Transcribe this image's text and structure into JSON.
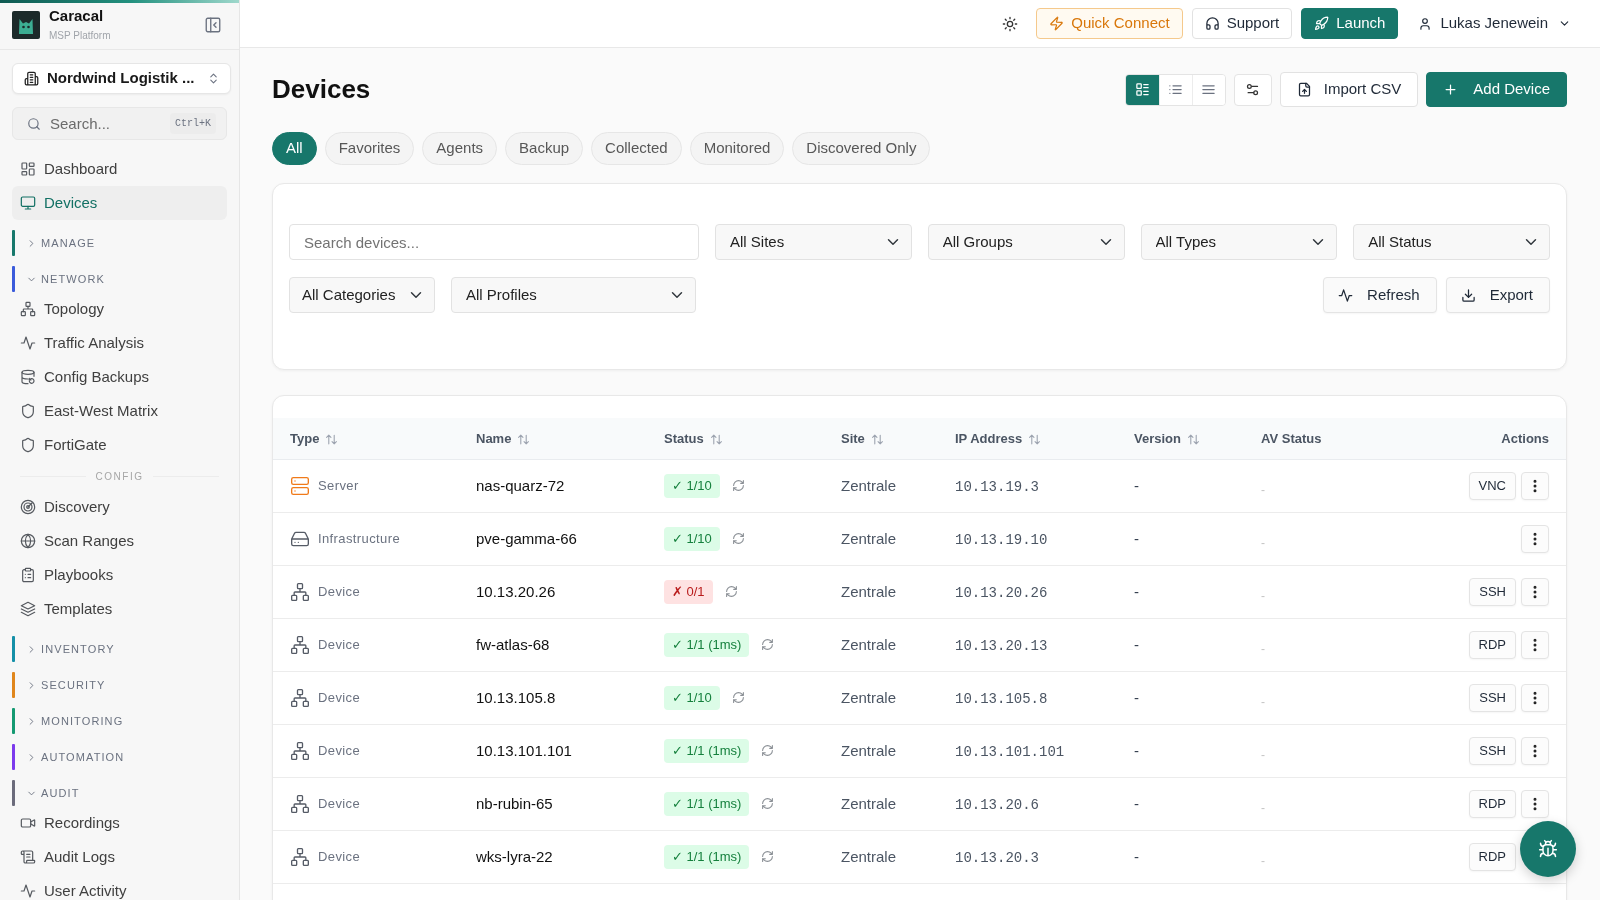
{
  "sidebar": {
    "brand": {
      "name": "Caracal",
      "subtitle": "MSP Platform"
    },
    "org_selector": {
      "value": "Nordwind Logistik ..."
    },
    "search": {
      "placeholder": "Search...",
      "shortcut": "Ctrl+K"
    },
    "nav": [
      {
        "kind": "link",
        "label": "Dashboard",
        "selected": false
      },
      {
        "kind": "link",
        "label": "Devices",
        "selected": true
      },
      {
        "kind": "group",
        "label": "MANAGE",
        "color": "#17786c",
        "expanded": false
      },
      {
        "kind": "group",
        "label": "NETWORK",
        "color": "#3b5bdb",
        "expanded": true,
        "children": [
          {
            "kind": "link",
            "label": "Topology",
            "selected": false
          },
          {
            "kind": "link",
            "label": "Traffic Analysis",
            "selected": false
          },
          {
            "kind": "link",
            "label": "Config Backups",
            "selected": false
          },
          {
            "kind": "link",
            "label": "East-West Matrix",
            "selected": false
          },
          {
            "kind": "link",
            "label": "FortiGate",
            "selected": false
          },
          {
            "kind": "heading",
            "label": "CONFIG"
          },
          {
            "kind": "link",
            "label": "Discovery",
            "selected": false
          },
          {
            "kind": "link",
            "label": "Scan Ranges",
            "selected": false
          },
          {
            "kind": "link",
            "label": "Playbooks",
            "selected": false
          },
          {
            "kind": "link",
            "label": "Templates",
            "selected": false
          }
        ]
      },
      {
        "kind": "group",
        "label": "INVENTORY",
        "color": "#1590a8",
        "expanded": false
      },
      {
        "kind": "group",
        "label": "SECURITY",
        "color": "#e0861c",
        "expanded": false
      },
      {
        "kind": "group",
        "label": "MONITORING",
        "color": "#159a72",
        "expanded": false
      },
      {
        "kind": "group",
        "label": "AUTOMATION",
        "color": "#7c3aed",
        "expanded": false
      },
      {
        "kind": "group",
        "label": "AUDIT",
        "color": "#6b6b7b",
        "expanded": true,
        "children": [
          {
            "kind": "link",
            "label": "Recordings",
            "selected": false
          },
          {
            "kind": "link",
            "label": "Audit Logs",
            "selected": false
          },
          {
            "kind": "link",
            "label": "User Activity",
            "selected": false
          }
        ]
      }
    ]
  },
  "topbar": {
    "actions": [
      {
        "kind": "warning",
        "label": "Quick Connect"
      },
      {
        "kind": "outline",
        "label": "Support"
      },
      {
        "kind": "primary",
        "label": "Launch"
      }
    ],
    "user": {
      "name": "Lukas Jenewein"
    }
  },
  "header": {
    "title": "Devices",
    "view_modes": [
      {
        "selected": true
      },
      {
        "selected": false
      },
      {
        "selected": false
      }
    ],
    "buttons": [
      {
        "kind": "outline",
        "label": "Import CSV"
      },
      {
        "kind": "primary",
        "label": "Add Device"
      }
    ]
  },
  "tabs": [
    {
      "label": "All",
      "selected": true
    },
    {
      "label": "Favorites",
      "selected": false
    },
    {
      "label": "Agents",
      "selected": false
    },
    {
      "label": "Backup",
      "selected": false
    },
    {
      "label": "Collected",
      "selected": false
    },
    {
      "label": "Monitored",
      "selected": false
    },
    {
      "label": "Discovered Only",
      "selected": false
    }
  ],
  "filters": {
    "search": {
      "placeholder": "Search devices..."
    },
    "selects": [
      {
        "value": "All Sites"
      },
      {
        "value": "All Groups"
      },
      {
        "value": "All Types"
      },
      {
        "value": "All Status"
      }
    ],
    "more_selects": [
      {
        "value": "All Categories"
      },
      {
        "value": "All Profiles"
      }
    ],
    "buttons": [
      {
        "label": "Refresh"
      },
      {
        "label": "Export"
      }
    ]
  },
  "table": {
    "columns": [
      {
        "label": "Type",
        "sortable": true
      },
      {
        "label": "Name",
        "sortable": true
      },
      {
        "label": "Status",
        "sortable": true
      },
      {
        "label": "Site",
        "sortable": true
      },
      {
        "label": "IP Address",
        "sortable": true
      },
      {
        "label": "Version",
        "sortable": true
      },
      {
        "label": "AV Status",
        "sortable": false
      },
      {
        "label": "Actions",
        "sortable": false
      }
    ],
    "rows": [
      {
        "type": {
          "kind": "server",
          "label": "Server"
        },
        "name": "nas-quarz-72",
        "status": {
          "kind": "ok",
          "text": "✓ 1/10"
        },
        "site": "Zentrale",
        "ip": "10.13.19.3",
        "version": "-",
        "av_status": "-",
        "connect": "VNC",
        "menu_button": true
      },
      {
        "type": {
          "kind": "infrastructure",
          "label": "Infrastructure"
        },
        "name": "pve-gamma-66",
        "status": {
          "kind": "ok",
          "text": "✓ 1/10"
        },
        "site": "Zentrale",
        "ip": "10.13.19.10",
        "version": "-",
        "av_status": "-",
        "menu_button": true
      },
      {
        "type": {
          "kind": "device",
          "label": "Device"
        },
        "name": "10.13.20.26",
        "status": {
          "kind": "fail",
          "text": "✗ 0/1"
        },
        "site": "Zentrale",
        "ip": "10.13.20.26",
        "version": "-",
        "av_status": "-",
        "connect": "SSH",
        "menu_button": true
      },
      {
        "type": {
          "kind": "device",
          "label": "Device"
        },
        "name": "fw-atlas-68",
        "status": {
          "kind": "ok",
          "text": "✓ 1/1 (1ms)"
        },
        "site": "Zentrale",
        "ip": "10.13.20.13",
        "version": "-",
        "av_status": "-",
        "connect": "RDP",
        "menu_button": true
      },
      {
        "type": {
          "kind": "device",
          "label": "Device"
        },
        "name": "10.13.105.8",
        "status": {
          "kind": "ok",
          "text": "✓ 1/10"
        },
        "site": "Zentrale",
        "ip": "10.13.105.8",
        "version": "-",
        "av_status": "-",
        "connect": "SSH",
        "menu_button": true
      },
      {
        "type": {
          "kind": "device",
          "label": "Device"
        },
        "name": "10.13.101.101",
        "status": {
          "kind": "ok",
          "text": "✓ 1/1 (1ms)"
        },
        "site": "Zentrale",
        "ip": "10.13.101.101",
        "version": "-",
        "av_status": "-",
        "connect": "SSH",
        "menu_button": true
      },
      {
        "type": {
          "kind": "device",
          "label": "Device"
        },
        "name": "nb-rubin-65",
        "status": {
          "kind": "ok",
          "text": "✓ 1/1 (1ms)"
        },
        "site": "Zentrale",
        "ip": "10.13.20.6",
        "version": "-",
        "av_status": "-",
        "connect": "RDP",
        "menu_button": true
      },
      {
        "type": {
          "kind": "device",
          "label": "Device"
        },
        "name": "wks-lyra-22",
        "status": {
          "kind": "ok",
          "text": "✓ 1/1 (1ms)"
        },
        "site": "Zentrale",
        "ip": "10.13.20.3",
        "version": "-",
        "av_status": "-",
        "connect": "RDP",
        "menu_button": false
      }
    ]
  }
}
